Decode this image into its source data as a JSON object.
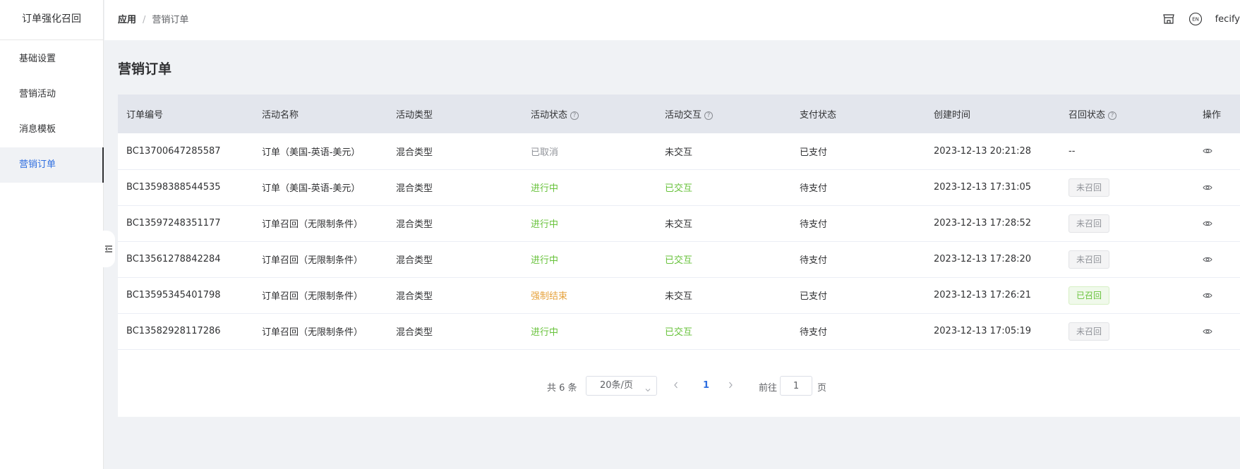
{
  "sidebar": {
    "app_title": "订单强化召回",
    "items": [
      {
        "label": "基础设置"
      },
      {
        "label": "营销活动"
      },
      {
        "label": "消息模板"
      },
      {
        "label": "营销订单",
        "active": true
      }
    ],
    "collapse_icon": "menu-fold-icon"
  },
  "header": {
    "breadcrumb": {
      "root": "应用",
      "separator": "/",
      "current": "营销订单"
    },
    "icons": [
      "store-icon",
      "language-en-icon"
    ],
    "username": "fecify"
  },
  "page": {
    "title": "营销订单"
  },
  "table": {
    "columns": [
      "订单编号",
      "活动名称",
      "活动类型",
      "活动状态",
      "活动交互",
      "支付状态",
      "创建时间",
      "召回状态",
      "操作"
    ],
    "help_icon": "?",
    "rows": [
      {
        "order_no": "BC13700647285587",
        "activity_name": "订单（美国-英语-美元）",
        "activity_type": "混合类型",
        "activity_status": "已取消",
        "interaction": "未交互",
        "pay_status": "已支付",
        "created": "2023-12-13 20:21:28",
        "recall_status": "--"
      },
      {
        "order_no": "BC13598388544535",
        "activity_name": "订单（美国-英语-美元）",
        "activity_type": "混合类型",
        "activity_status": "进行中",
        "interaction": "已交互",
        "pay_status": "待支付",
        "created": "2023-12-13 17:31:05",
        "recall_status": "未召回"
      },
      {
        "order_no": "BC13597248351177",
        "activity_name": "订单召回（无限制条件）",
        "activity_type": "混合类型",
        "activity_status": "进行中",
        "interaction": "未交互",
        "pay_status": "待支付",
        "created": "2023-12-13 17:28:52",
        "recall_status": "未召回"
      },
      {
        "order_no": "BC13561278842284",
        "activity_name": "订单召回（无限制条件）",
        "activity_type": "混合类型",
        "activity_status": "进行中",
        "interaction": "已交互",
        "pay_status": "待支付",
        "created": "2023-12-13 17:28:20",
        "recall_status": "未召回"
      },
      {
        "order_no": "BC13595345401798",
        "activity_name": "订单召回（无限制条件）",
        "activity_type": "混合类型",
        "activity_status": "强制结束",
        "interaction": "未交互",
        "pay_status": "已支付",
        "created": "2023-12-13 17:26:21",
        "recall_status": "已召回"
      },
      {
        "order_no": "BC13582928117286",
        "activity_name": "订单召回（无限制条件）",
        "activity_type": "混合类型",
        "activity_status": "进行中",
        "interaction": "已交互",
        "pay_status": "待支付",
        "created": "2023-12-13 17:05:19",
        "recall_status": "未召回"
      }
    ],
    "action_icon": "eye-icon"
  },
  "pagination": {
    "total": "共 6 条",
    "page_size": "20条/页",
    "current_page": "1",
    "goto_label": "前往",
    "goto_value": "1",
    "page_suffix": "页"
  },
  "colors": {
    "accent": "#2f6fe0",
    "success": "#67c23a",
    "warning": "#e6a23c",
    "muted": "#909399"
  }
}
